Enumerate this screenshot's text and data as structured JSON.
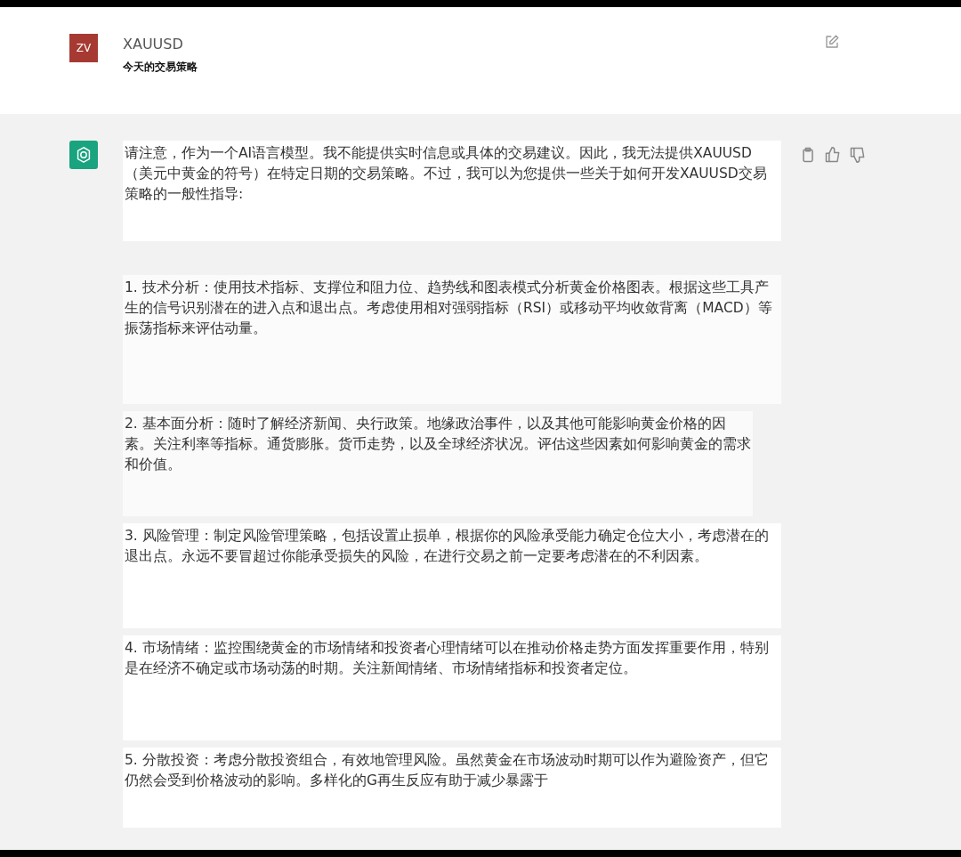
{
  "user_message": {
    "avatar": "ZV",
    "title": "XAUUSD",
    "text": "今天的交易策略"
  },
  "assistant_message": {
    "paragraphs": [
      "请注意，作为一个AI语言模型。我不能提供实时信息或具体的交易建议。因此，我无法提供XAUUSD（美元中黄金的符号）在特定日期的交易策略。不过，我可以为您提供一些关于如何开发XAUUSD交易策略的一般性指导:",
      "1. 技术分析：使用技术指标、支撑位和阻力位、趋势线和图表模式分析黄金价格图表。根据这些工具产生的信号识别潜在的进入点和退出点。考虑使用相对强弱指标（RSI）或移动平均收敛背离（MACD）等振荡指标来评估动量。",
      "2. 基本面分析：随时了解经济新闻、央行政策。地缘政治事件，以及其他可能影响黄金价格的因素。关注利率等指标。通货膨胀。货币走势，以及全球经济状况。评估这些因素如何影响黄金的需求和价值。",
      "3. 风险管理：制定风险管理策略，包括设置止损单，根据你的风险承受能力确定仓位大小，考虑潜在的退出点。永远不要冒超过你能承受损失的风险，在进行交易之前一定要考虑潜在的不利因素。",
      "4. 市场情绪：监控围绕黄金的市场情绪和投资者心理情绪可以在推动价格走势方面发挥重要作用，特别是在经济不确定或市场动荡的时期。关注新闻情绪、市场情绪指标和投资者定位。",
      "5. 分散投资：考虑分散投资组合，有效地管理风险。虽然黄金在市场波动时期可以作为避险资产，但它仍然会受到价格波动的影响。多样化的G再生反应有助于减少暴露于"
    ]
  }
}
